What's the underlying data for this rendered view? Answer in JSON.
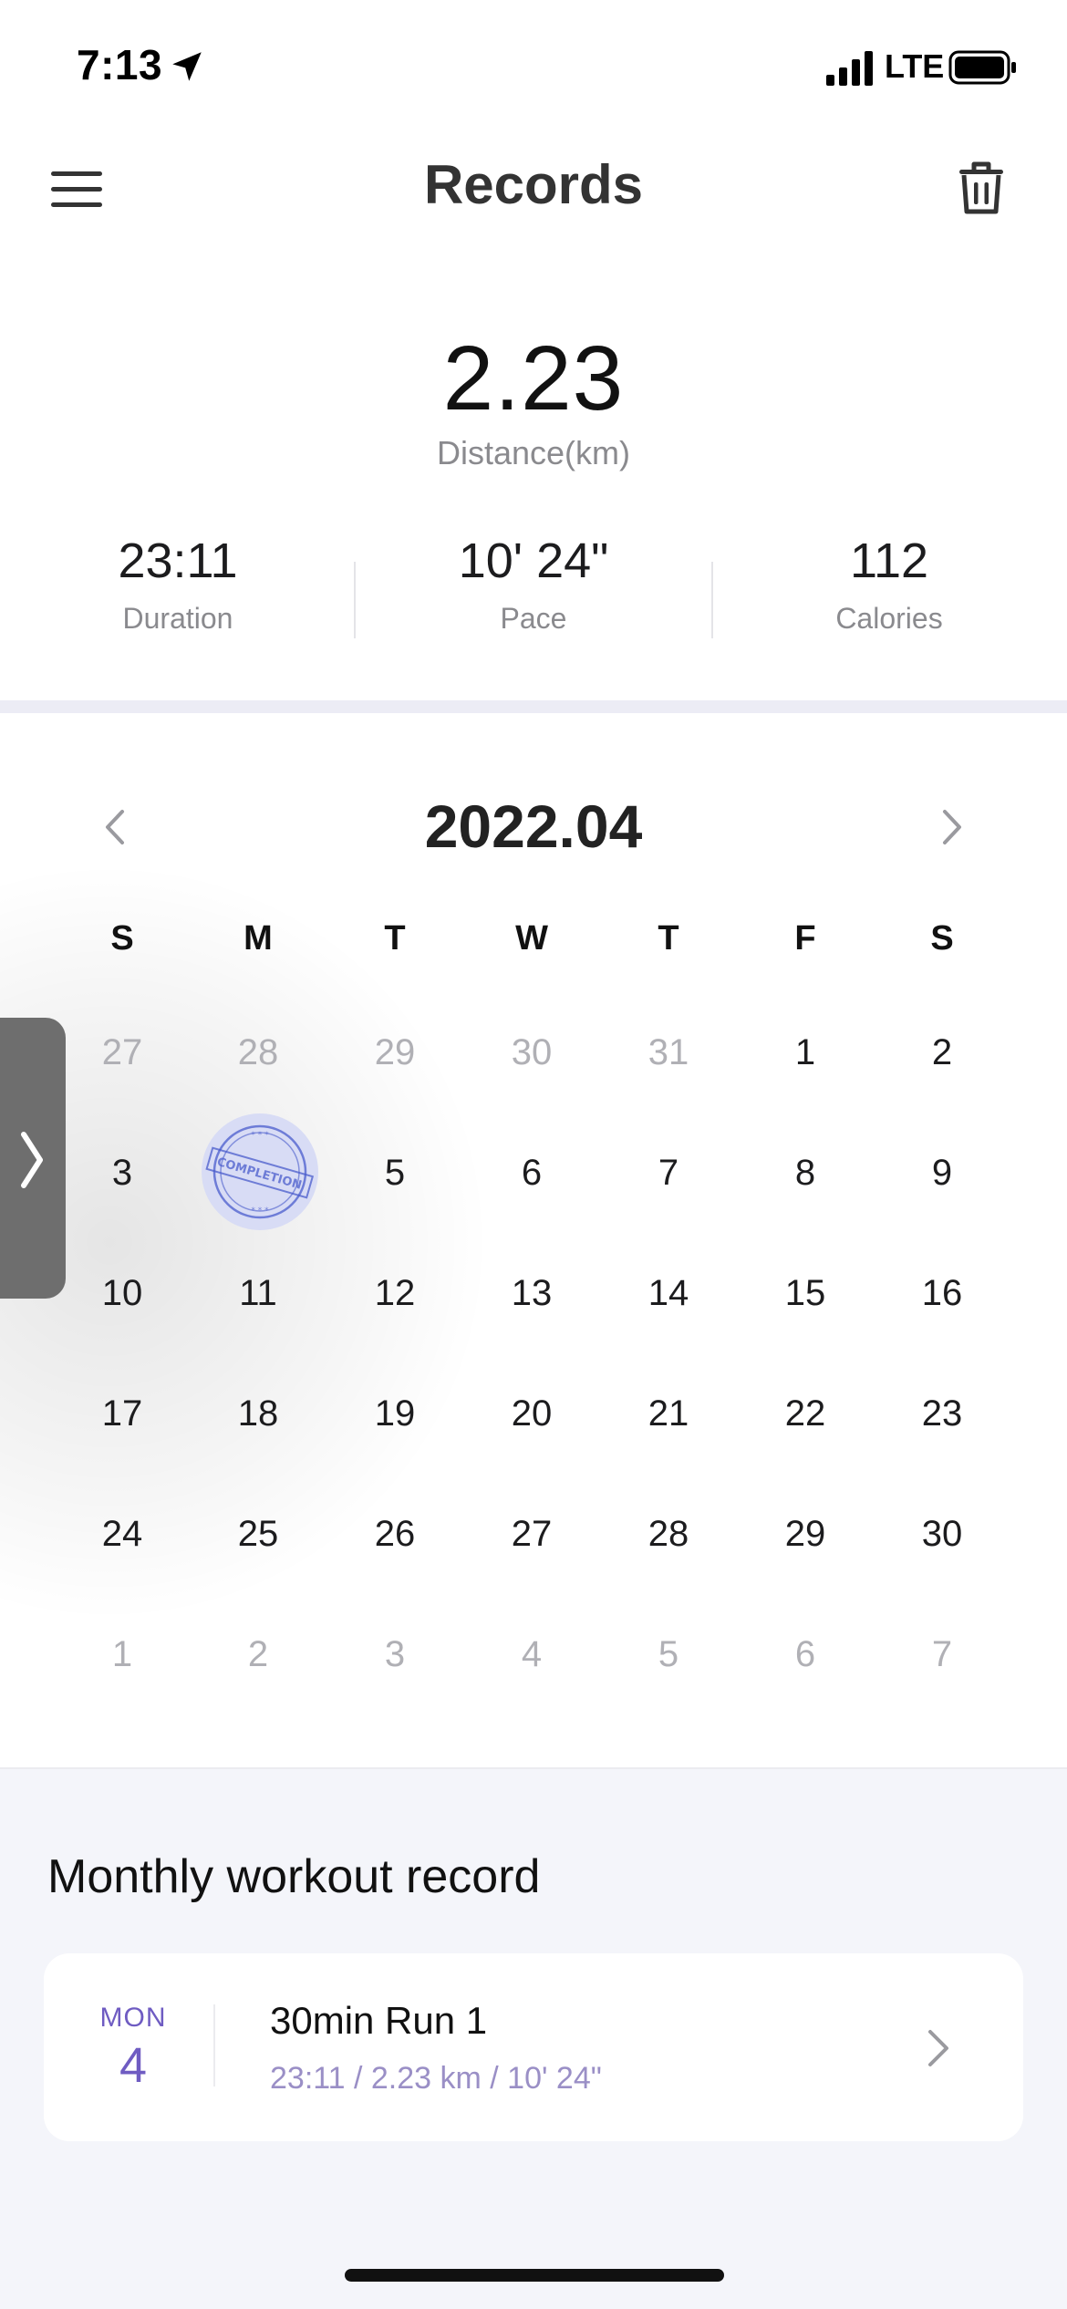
{
  "status_bar": {
    "time": "7:13",
    "network": "LTE",
    "location_icon": "location-arrow-icon",
    "signal_icon": "signal-bars-icon",
    "battery_icon": "battery-icon"
  },
  "header": {
    "title": "Records",
    "menu_icon": "hamburger-menu-icon",
    "delete_icon": "trash-icon"
  },
  "summary": {
    "distance_value": "2.23",
    "distance_label": "Distance(km)",
    "stats": [
      {
        "value": "23:11",
        "label": "Duration"
      },
      {
        "value": "10' 24\"",
        "label": "Pace"
      },
      {
        "value": "112",
        "label": "Calories"
      }
    ]
  },
  "calendar": {
    "month": "2022.04",
    "weekdays": [
      "S",
      "M",
      "T",
      "W",
      "T",
      "F",
      "S"
    ],
    "weeks": [
      [
        "27",
        "28",
        "29",
        "30",
        "31",
        "1",
        "2"
      ],
      [
        "3",
        "4",
        "5",
        "6",
        "7",
        "8",
        "9"
      ],
      [
        "10",
        "11",
        "12",
        "13",
        "14",
        "15",
        "16"
      ],
      [
        "17",
        "18",
        "19",
        "20",
        "21",
        "22",
        "23"
      ],
      [
        "24",
        "25",
        "26",
        "27",
        "28",
        "29",
        "30"
      ],
      [
        "1",
        "2",
        "3",
        "4",
        "5",
        "6",
        "7"
      ]
    ],
    "stamp_text": "COMPLETION",
    "stamped_day": "4"
  },
  "monthly": {
    "title": "Monthly workout record",
    "records": [
      {
        "dow": "MON",
        "day": "4",
        "title": "30min Run 1",
        "detail": "23:11 / 2.23 km / 10' 24\""
      }
    ]
  },
  "colors": {
    "accent": "#6f5cc2",
    "accent_light": "#9a8fc6",
    "stamp": "#3a4fc0",
    "background_section": "#f4f5fa"
  }
}
